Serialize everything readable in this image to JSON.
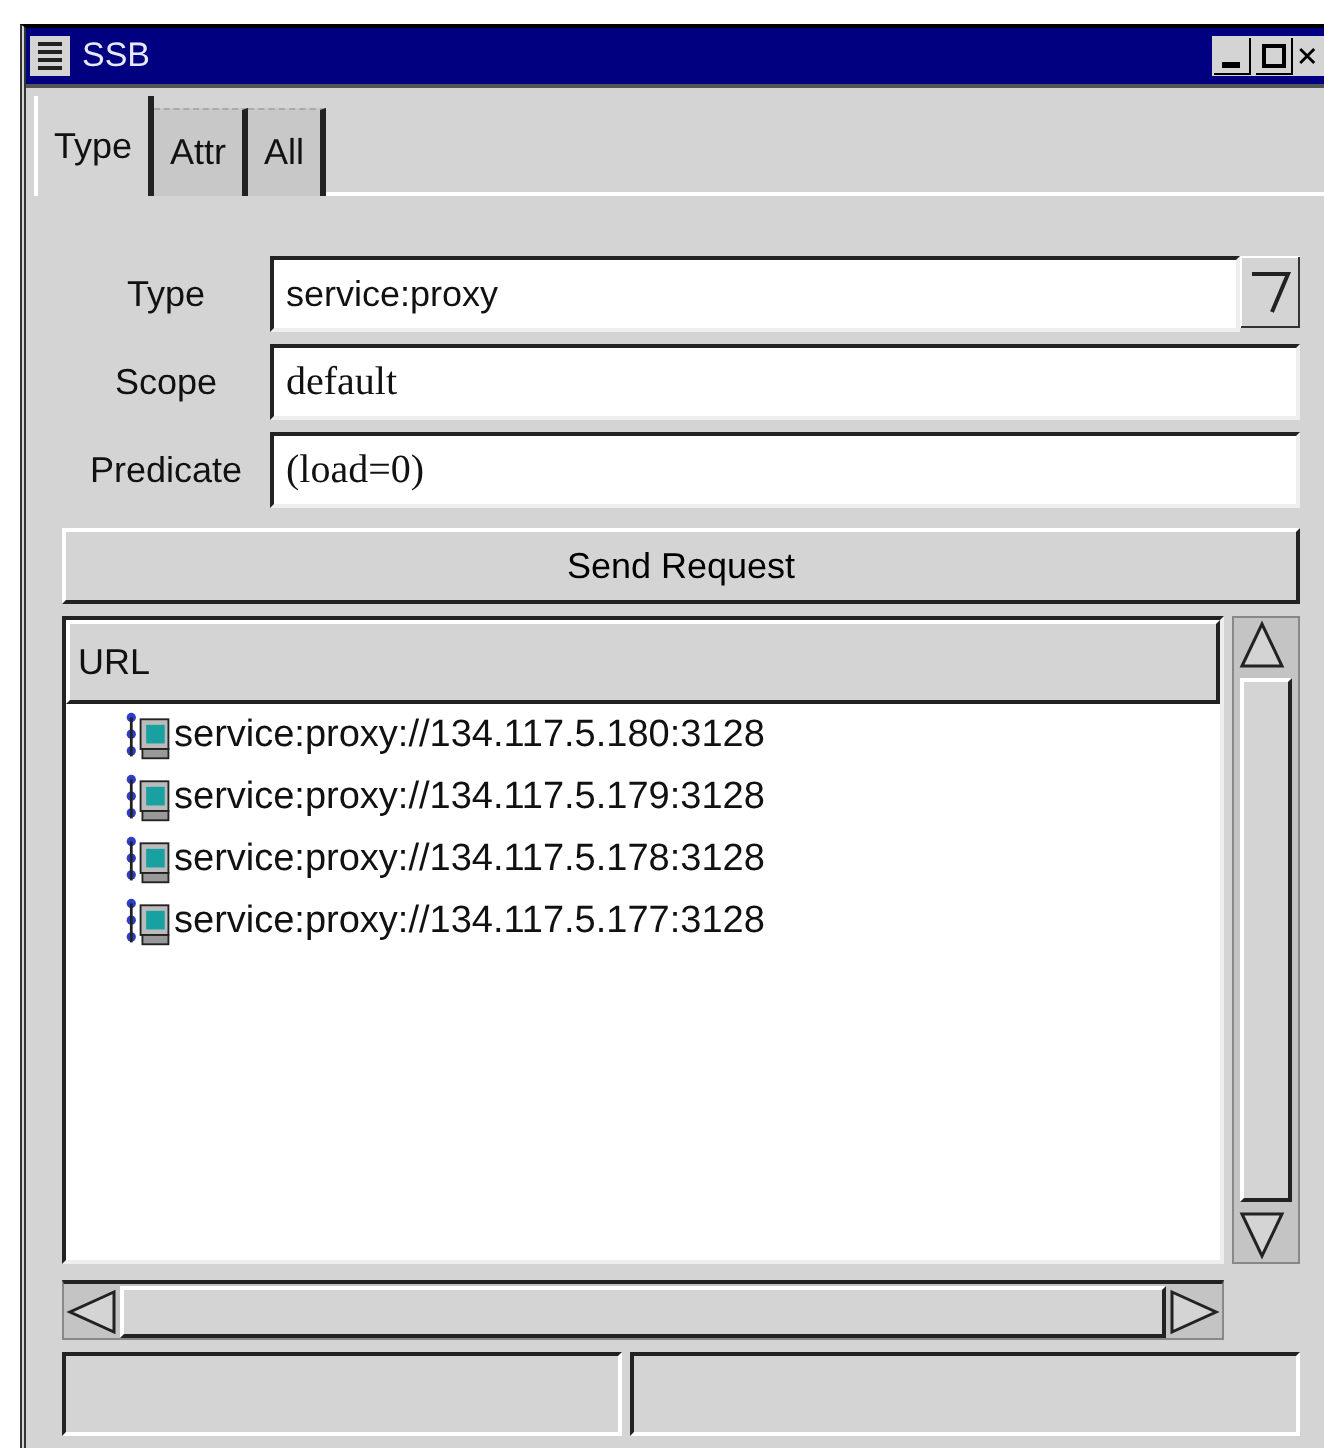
{
  "window": {
    "title": "SSB"
  },
  "tabs": [
    {
      "label": "Type",
      "selected": true
    },
    {
      "label": "Attr",
      "selected": false
    },
    {
      "label": "All",
      "selected": false
    }
  ],
  "form": [
    {
      "label": "Type",
      "value": "service:proxy",
      "kind": "combo"
    },
    {
      "label": "Scope",
      "value": "default",
      "kind": "text"
    },
    {
      "label": "Predicate",
      "value": "(load=0)",
      "kind": "text"
    }
  ],
  "send_button": "Send Request",
  "list": {
    "column": "URL",
    "rows": [
      "service:proxy://134.117.5.180:3128",
      "service:proxy://134.117.5.179:3128",
      "service:proxy://134.117.5.178:3128",
      "service:proxy://134.117.5.177:3128"
    ]
  }
}
